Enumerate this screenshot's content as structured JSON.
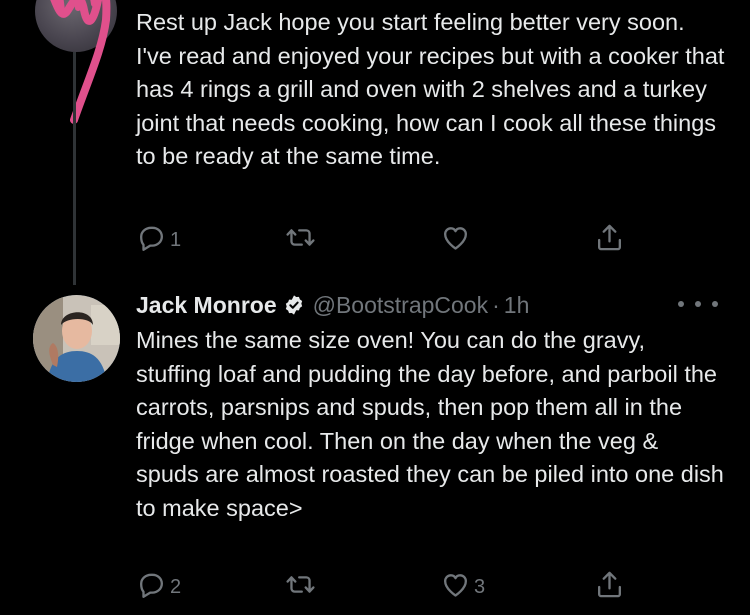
{
  "tweet1": {
    "text": "Rest up Jack hope you start feeling better very soon. I've read and enjoyed your recipes but with a cooker that has 4 rings a grill and oven with 2 shelves and a turkey joint that needs cooking, how can I cook all these things to be ready at the same time.",
    "reply_count": "1",
    "retweet_count": "",
    "like_count": "",
    "icons": [
      "reply-icon",
      "retweet-icon",
      "like-icon",
      "share-icon"
    ]
  },
  "tweet2": {
    "name": "Jack Monroe",
    "handle": "@BootstrapCook",
    "separator": "·",
    "time": "1h",
    "text": "Mines the same size oven! You can do the gravy, stuffing loaf and pudding the day before, and parboil the carrots, parsnips and spuds, then pop them all in the fridge when cool. Then on the day when the veg & spuds are almost roasted they can be piled into one dish to make space>",
    "reply_count": "2",
    "retweet_count": "",
    "like_count": "3",
    "icons": [
      "verified-icon",
      "more-icon",
      "reply-icon",
      "retweet-icon",
      "like-icon",
      "share-icon"
    ]
  },
  "colors": {
    "background": "#000000",
    "text": "#e7e9ea",
    "secondary": "#71767b",
    "scribble": "#e0508c"
  }
}
